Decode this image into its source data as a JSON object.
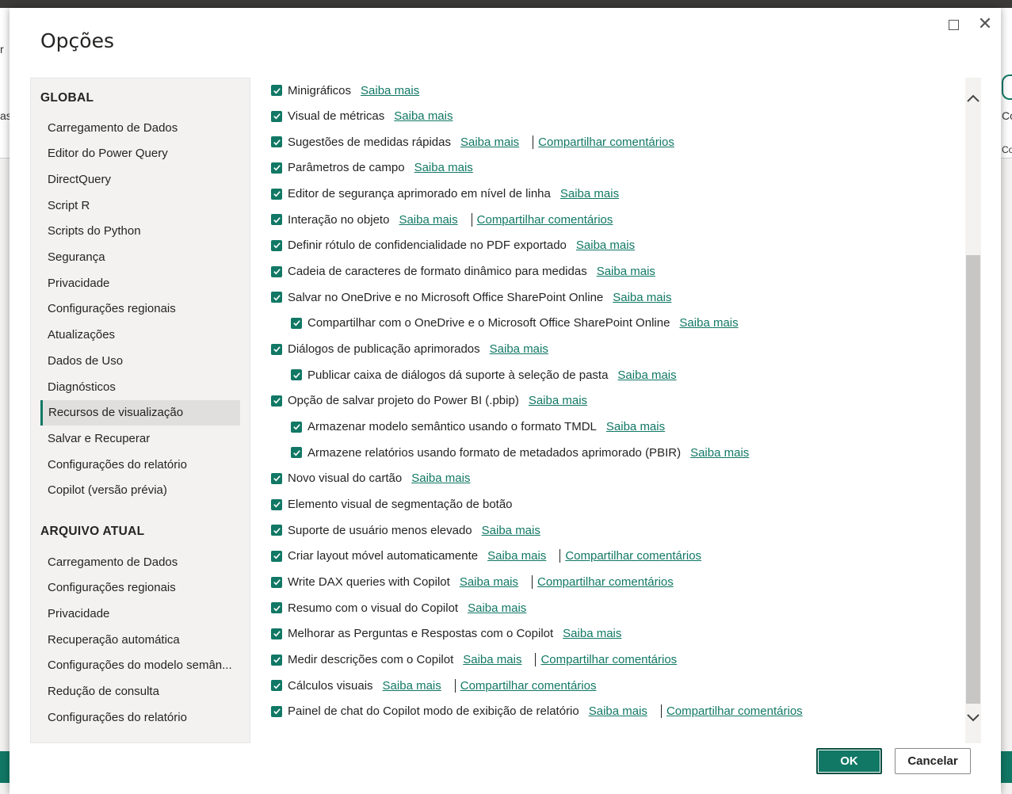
{
  "background": {
    "left_fragments": [
      "r",
      "as"
    ],
    "right_fragments": [
      "Co",
      "Co"
    ]
  },
  "dialog": {
    "title": "Opções",
    "maximize_label": "Maximizar",
    "close_label": "Fechar"
  },
  "sidebar": {
    "global_header": "GLOBAL",
    "global_items": [
      "Carregamento de Dados",
      "Editor do Power Query",
      "DirectQuery",
      "Script R",
      "Scripts do Python",
      "Segurança",
      "Privacidade",
      "Configurações regionais",
      "Atualizações",
      "Dados de Uso",
      "Diagnósticos",
      "Recursos de visualização",
      "Salvar e Recuperar",
      "Configurações do relatório",
      "Copilot (versão prévia)"
    ],
    "selected_index": 11,
    "file_header": "ARQUIVO ATUAL",
    "file_items": [
      "Carregamento de Dados",
      "Configurações regionais",
      "Privacidade",
      "Recuperação automática",
      "Configurações do modelo semân...",
      "Redução de consulta",
      "Configurações do relatório"
    ]
  },
  "options": {
    "learn_more": "Saiba mais",
    "feedback": "Compartilhar comentários",
    "items": [
      {
        "label": "Minigráficos",
        "indent": 0,
        "feedback": false
      },
      {
        "label": "Visual de métricas",
        "indent": 0,
        "feedback": false
      },
      {
        "label": "Sugestões de medidas rápidas",
        "indent": 0,
        "feedback": true
      },
      {
        "label": "Parâmetros de campo",
        "indent": 0,
        "feedback": false
      },
      {
        "label": "Editor de segurança aprimorado em nível de linha",
        "indent": 0,
        "feedback": false
      },
      {
        "label": "Interação no objeto",
        "indent": 0,
        "feedback": true
      },
      {
        "label": "Definir rótulo de confidencialidade no PDF exportado",
        "indent": 0,
        "feedback": false
      },
      {
        "label": "Cadeia de caracteres de formato dinâmico para medidas",
        "indent": 0,
        "feedback": false
      },
      {
        "label": "Salvar no OneDrive e no Microsoft Office SharePoint Online",
        "indent": 0,
        "feedback": false
      },
      {
        "label": "Compartilhar com o OneDrive e o Microsoft Office SharePoint Online",
        "indent": 1,
        "feedback": false
      },
      {
        "label": "Diálogos de publicação aprimorados",
        "indent": 0,
        "feedback": false
      },
      {
        "label": "Publicar caixa de diálogos dá suporte à seleção de pasta",
        "indent": 1,
        "feedback": false
      },
      {
        "label": "Opção de salvar projeto do Power BI (.pbip)",
        "indent": 0,
        "feedback": false
      },
      {
        "label": "Armazenar modelo semântico usando o formato TMDL",
        "indent": 1,
        "feedback": false
      },
      {
        "label": "Armazene relatórios usando formato de metadados aprimorado (PBIR)",
        "indent": 1,
        "feedback": false
      },
      {
        "label": "Novo visual do cartão",
        "indent": 0,
        "feedback": false
      },
      {
        "label": "Elemento visual de segmentação de botão",
        "indent": 0,
        "feedback": false,
        "no_link": true
      },
      {
        "label": "Suporte de usuário menos elevado",
        "indent": 0,
        "feedback": false
      },
      {
        "label": "Criar layout móvel automaticamente",
        "indent": 0,
        "feedback": true
      },
      {
        "label": "Write DAX queries with Copilot",
        "indent": 0,
        "feedback": true
      },
      {
        "label": "Resumo com o visual do Copilot",
        "indent": 0,
        "feedback": false
      },
      {
        "label": "Melhorar as Perguntas e Respostas com o Copilot",
        "indent": 0,
        "feedback": false
      },
      {
        "label": "Medir descrições com o Copilot",
        "indent": 0,
        "feedback": true
      },
      {
        "label": "Cálculos visuais",
        "indent": 0,
        "feedback": true
      },
      {
        "label": "Painel de chat do Copilot modo de exibição de relatório",
        "indent": 0,
        "feedback": true
      }
    ]
  },
  "footer": {
    "ok_label": "OK",
    "cancel_label": "Cancelar"
  },
  "colors": {
    "accent": "#117865",
    "text": "#252423",
    "sidebar_bg": "#f3f2f1",
    "selected_bg": "#e1dfdd"
  }
}
